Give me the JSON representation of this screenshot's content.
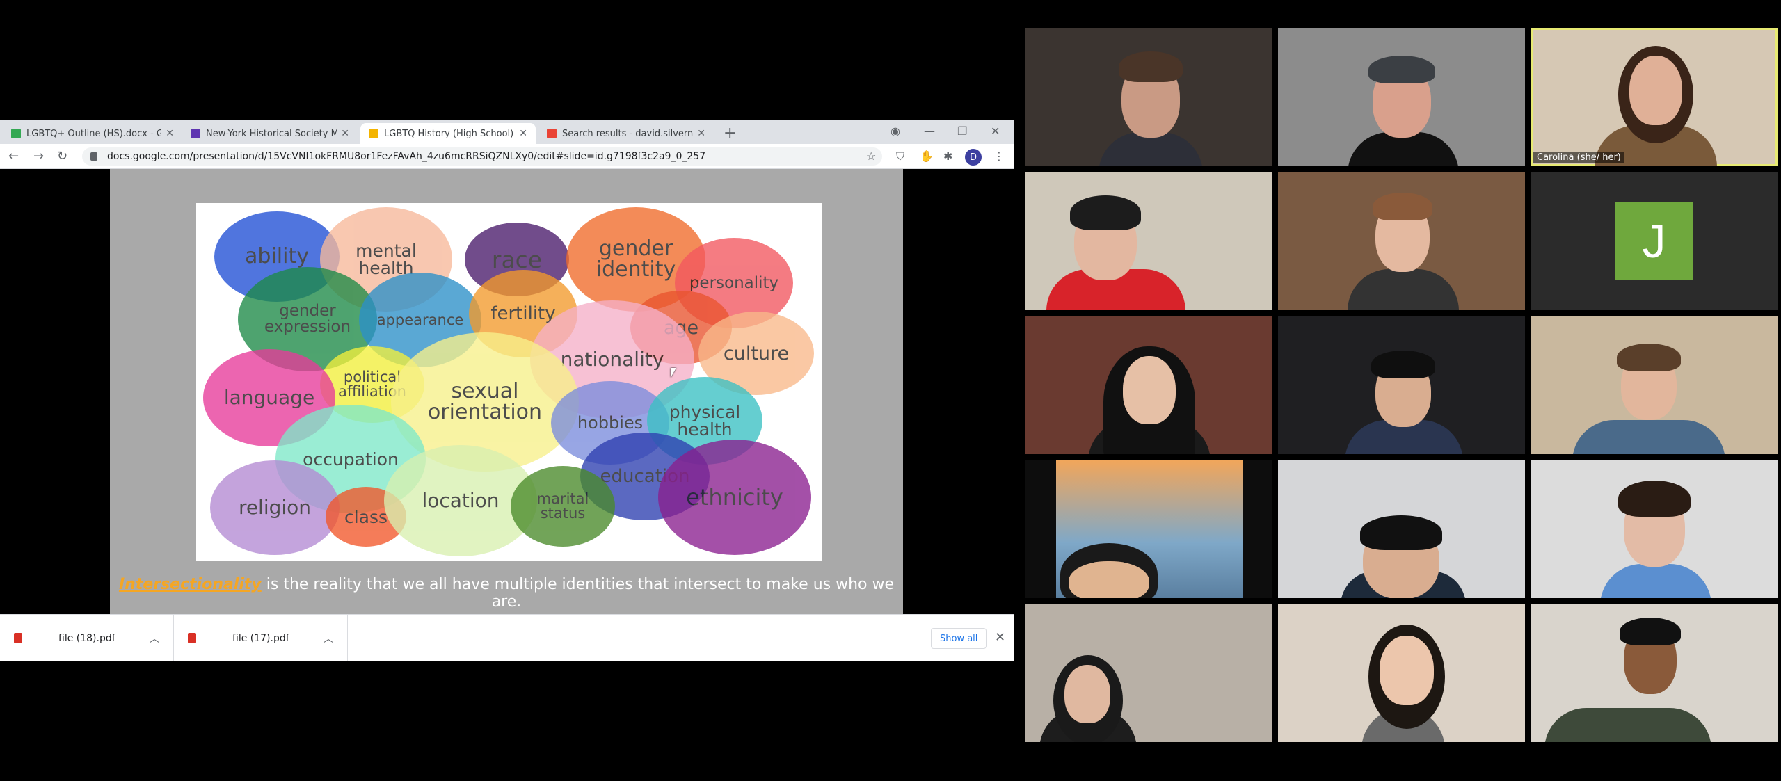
{
  "browser": {
    "tabs": [
      {
        "title": "LGBTQ+ Outline (HS).docx - Goo",
        "color": "#34a853"
      },
      {
        "title": "New-York Historical Society Mus",
        "color": "#5e35b1"
      },
      {
        "title": "LGBTQ History (High School) - G",
        "color": "#f4b400"
      },
      {
        "title": "Search results - david.silvernail@",
        "color": "#ea4335"
      }
    ],
    "url": "docs.google.com/presentation/d/15VcVNI1okFRMU8or1FezFAvAh_4zu6mcRRSiQZNLXy0/edit#slide=id.g7198f3c2a9_0_257",
    "profile_initial": "D"
  },
  "slide": {
    "words": [
      {
        "text": "ability",
        "color": "#1f4fd6"
      },
      {
        "text": "mental\nhealth",
        "color": "#f7b89a"
      },
      {
        "text": "race",
        "color": "#4a1a6b"
      },
      {
        "text": "gender\nidentity",
        "color": "#f06b2a"
      },
      {
        "text": "personality",
        "color": "#f2575f"
      },
      {
        "text": "gender\nexpression",
        "color": "#1d8a47"
      },
      {
        "text": "appearance",
        "color": "#2c90c9"
      },
      {
        "text": "fertility",
        "color": "#f39a2c"
      },
      {
        "text": "age",
        "color": "#e9542f"
      },
      {
        "text": "culture",
        "color": "#f9b98a"
      },
      {
        "text": "nationality",
        "color": "#f6b0c8"
      },
      {
        "text": "political\naffiliation",
        "color": "#f2ef3c"
      },
      {
        "text": "language",
        "color": "#e73a9a"
      },
      {
        "text": "sexual\norientation",
        "color": "#f7f08a"
      },
      {
        "text": "hobbies",
        "color": "#7b8ddd"
      },
      {
        "text": "physical\nhealth",
        "color": "#3bc1c4"
      },
      {
        "text": "occupation",
        "color": "#7ee8c8"
      },
      {
        "text": "education",
        "color": "#2e3fb0"
      },
      {
        "text": "ethnicity",
        "color": "#8a1f8f"
      },
      {
        "text": "religion",
        "color": "#b48ad3"
      },
      {
        "text": "class",
        "color": "#f2572a"
      },
      {
        "text": "location",
        "color": "#d8f0b0"
      },
      {
        "text": "marital\nstatus",
        "color": "#4a8a2a"
      }
    ],
    "caption_highlight": "Intersectionality",
    "caption_rest": " is the reality that we all have multiple identities that intersect to make us who we are."
  },
  "downloads": {
    "files": [
      "file (18).pdf",
      "file (17).pdf"
    ],
    "show_all": "Show all"
  },
  "gallery": {
    "speaker_name": "Carolina (she/ her)",
    "avatar_initial": "J"
  }
}
